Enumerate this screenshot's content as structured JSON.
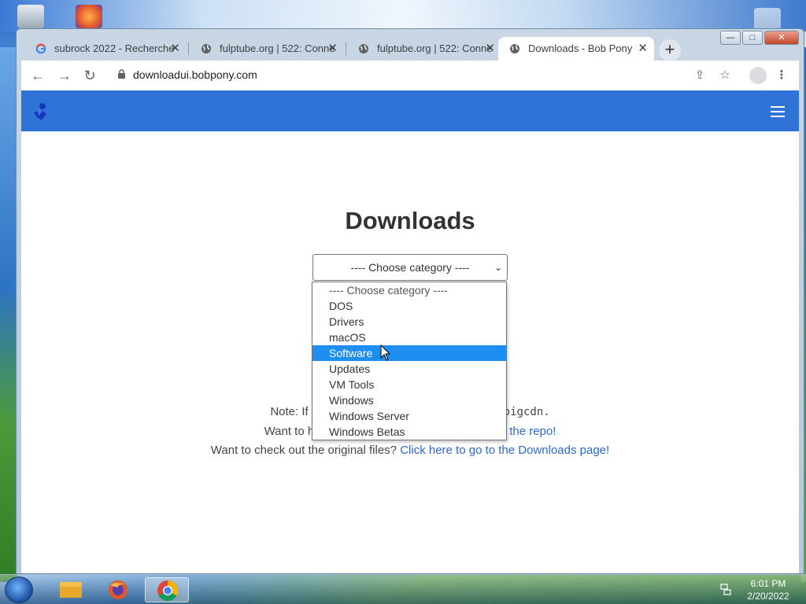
{
  "browser": {
    "tabs": [
      {
        "title": "subrock 2022 - Recherche",
        "icon": "google-icon"
      },
      {
        "title": "fulptube.org | 522: Conne",
        "icon": "globe-icon"
      },
      {
        "title": "fulptube.org | 522: Conne",
        "icon": "globe-icon"
      },
      {
        "title": "Downloads - Bob Pony",
        "icon": "globe-icon"
      }
    ],
    "new_tab_label": "+",
    "address": "downloadui.bobpony.com",
    "window_buttons": {
      "minimize": "—",
      "maximize": "□",
      "close": "✕"
    }
  },
  "page": {
    "heading": "Downloads",
    "select_value": "---- Choose category ----",
    "note_prefix": "Note: If",
    "note_suffix": "pigcdn.",
    "want_prefix": "Want to h",
    "want_link": "the repo!",
    "check_text": "Want to check out the original files?",
    "check_link": "Click here to go to the Downloads page!"
  },
  "dropdown": {
    "options": [
      "---- Choose category ----",
      "DOS",
      "Drivers",
      "macOS",
      "Software",
      "Updates",
      "VM Tools",
      "Windows",
      "Windows Server",
      "Windows Betas"
    ],
    "highlighted": "Software"
  },
  "taskbar": {
    "time": "6:01 PM",
    "date": "2/20/2022",
    "apps": [
      "file-explorer-icon",
      "firefox-icon",
      "chrome-icon"
    ]
  },
  "colors": {
    "navbar": "#2f73d8",
    "link": "#2d67d1",
    "highlight": "#1e8ff0"
  }
}
